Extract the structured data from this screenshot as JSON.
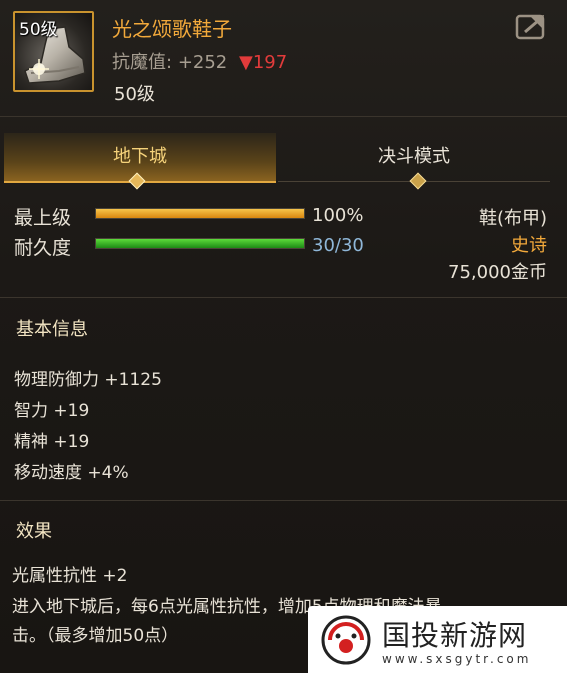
{
  "item": {
    "level_badge": "50级",
    "name": "光之颂歌鞋子",
    "stat_label": "抗魔值:",
    "stat_value": "+252",
    "stat_down": "▼197",
    "required_level": "50级",
    "icon": "shoe-icon"
  },
  "tabs": [
    {
      "label": "地下城",
      "active": true
    },
    {
      "label": "决斗模式",
      "active": false
    }
  ],
  "bars": {
    "top_level": {
      "label": "最上级",
      "value_text": "100%",
      "fraction": 1.0,
      "color": "#f0a62a"
    },
    "durability": {
      "label": "耐久度",
      "value_text": "30/30",
      "fraction": 1.0,
      "color": "#3fbf2a"
    }
  },
  "info": {
    "type": "鞋(布甲)",
    "rarity": "史诗",
    "price": "75,000金币",
    "rarity_color": "#f2a93b"
  },
  "basic": {
    "title": "基本信息",
    "attrs": [
      "物理防御力 +1125",
      "智力 +19",
      "精神 +19",
      "移动速度 +4%"
    ]
  },
  "effect": {
    "title": "效果",
    "lines": [
      "光属性抗性 +2",
      "进入地下城后，每6点光属性抗性，增加5点物理和魔法暴",
      "击。（最多增加50点）"
    ]
  },
  "watermark": {
    "name": "国投新游网",
    "url": "www.sxsgytr.com"
  }
}
